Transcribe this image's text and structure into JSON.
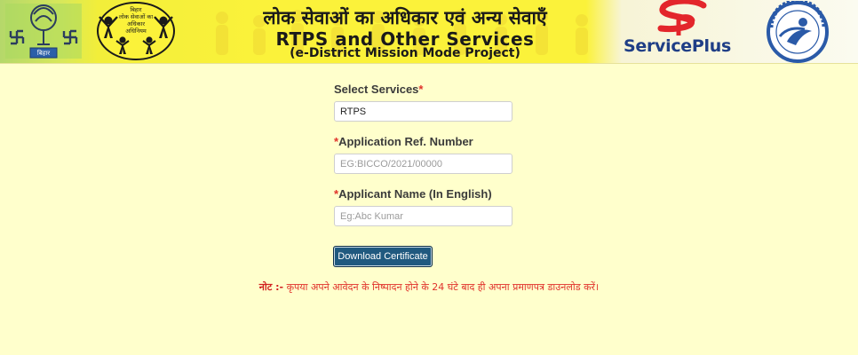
{
  "header": {
    "title_hindi": "लोक सेवाओं का अधिकार एवं अन्य सेवाएँ",
    "title_en": "RTPS and Other Services",
    "subtitle": "(e-District Mission Mode Project)",
    "brand": {
      "part1": "Service",
      "part2": "Plus"
    },
    "emblem_text": [
      "बिहार",
      "लोक सेवाओं का",
      "अधिकार",
      "अधिनियम"
    ],
    "left_logo_tag": "बिहार",
    "colors": {
      "banner": "#fbf23a",
      "brand_blue": "#1f3e86",
      "brand_red": "#e3262b"
    }
  },
  "form": {
    "service": {
      "label": "Select Services",
      "required_mark": "*",
      "value": "RTPS"
    },
    "ref_number": {
      "required_mark": "*",
      "label": "Application Ref. Number",
      "placeholder": "EG:BICCO/2021/00000",
      "value": ""
    },
    "applicant_name": {
      "required_mark": "*",
      "label": "Applicant Name (In English)",
      "placeholder": "Eg:Abc Kumar",
      "value": ""
    },
    "submit_label": "Download Certificate"
  },
  "note": {
    "prefix": "नोट :-",
    "text": " कृपया अपने आवेदन के निष्पादन होने के 24 घंटे बाद ही अपना प्रमाणपत्र डाउनलोड करें।"
  },
  "colors": {
    "page_bg": "#ffffcc",
    "button_bg": "#20597f",
    "required": "#e0322b"
  }
}
